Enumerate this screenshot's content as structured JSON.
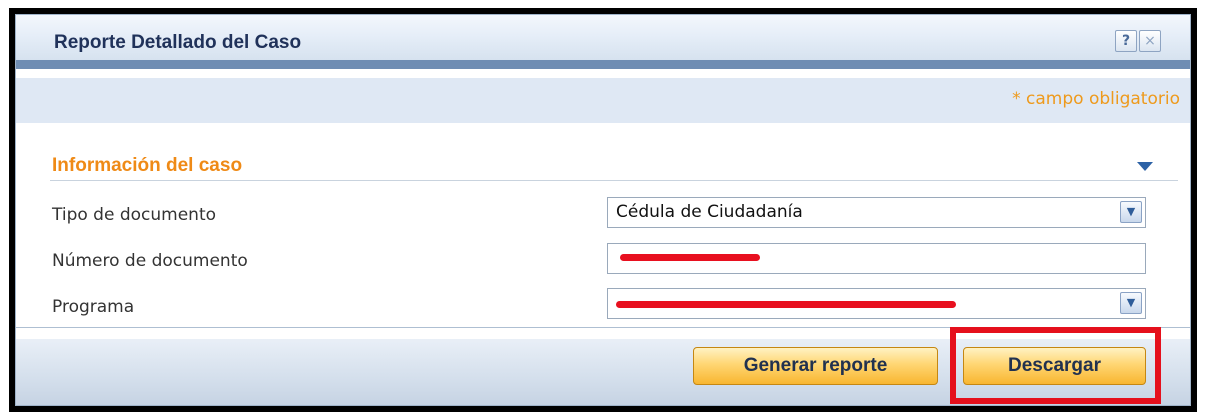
{
  "dialog": {
    "title": "Reporte Detallado del Caso",
    "help_symbol": "?",
    "close_symbol": "×"
  },
  "required_note": "* campo obligatorio",
  "section": {
    "title": "Información del caso"
  },
  "form": {
    "tipo_documento": {
      "label": "Tipo de documento",
      "value": "Cédula de Ciudadanía"
    },
    "numero_documento": {
      "label": "Número de documento",
      "value": ""
    },
    "programa": {
      "label": "Programa",
      "value": ""
    }
  },
  "buttons": {
    "generar": "Generar reporte",
    "descargar": "Descargar"
  },
  "icons": [
    "help-icon",
    "close-icon",
    "collapse-arrow-icon",
    "dropdown-arrow-icon"
  ],
  "colors": {
    "accent_orange": "#ef8a16",
    "title_blue": "#20325a",
    "highlight_red": "#e5101c"
  }
}
